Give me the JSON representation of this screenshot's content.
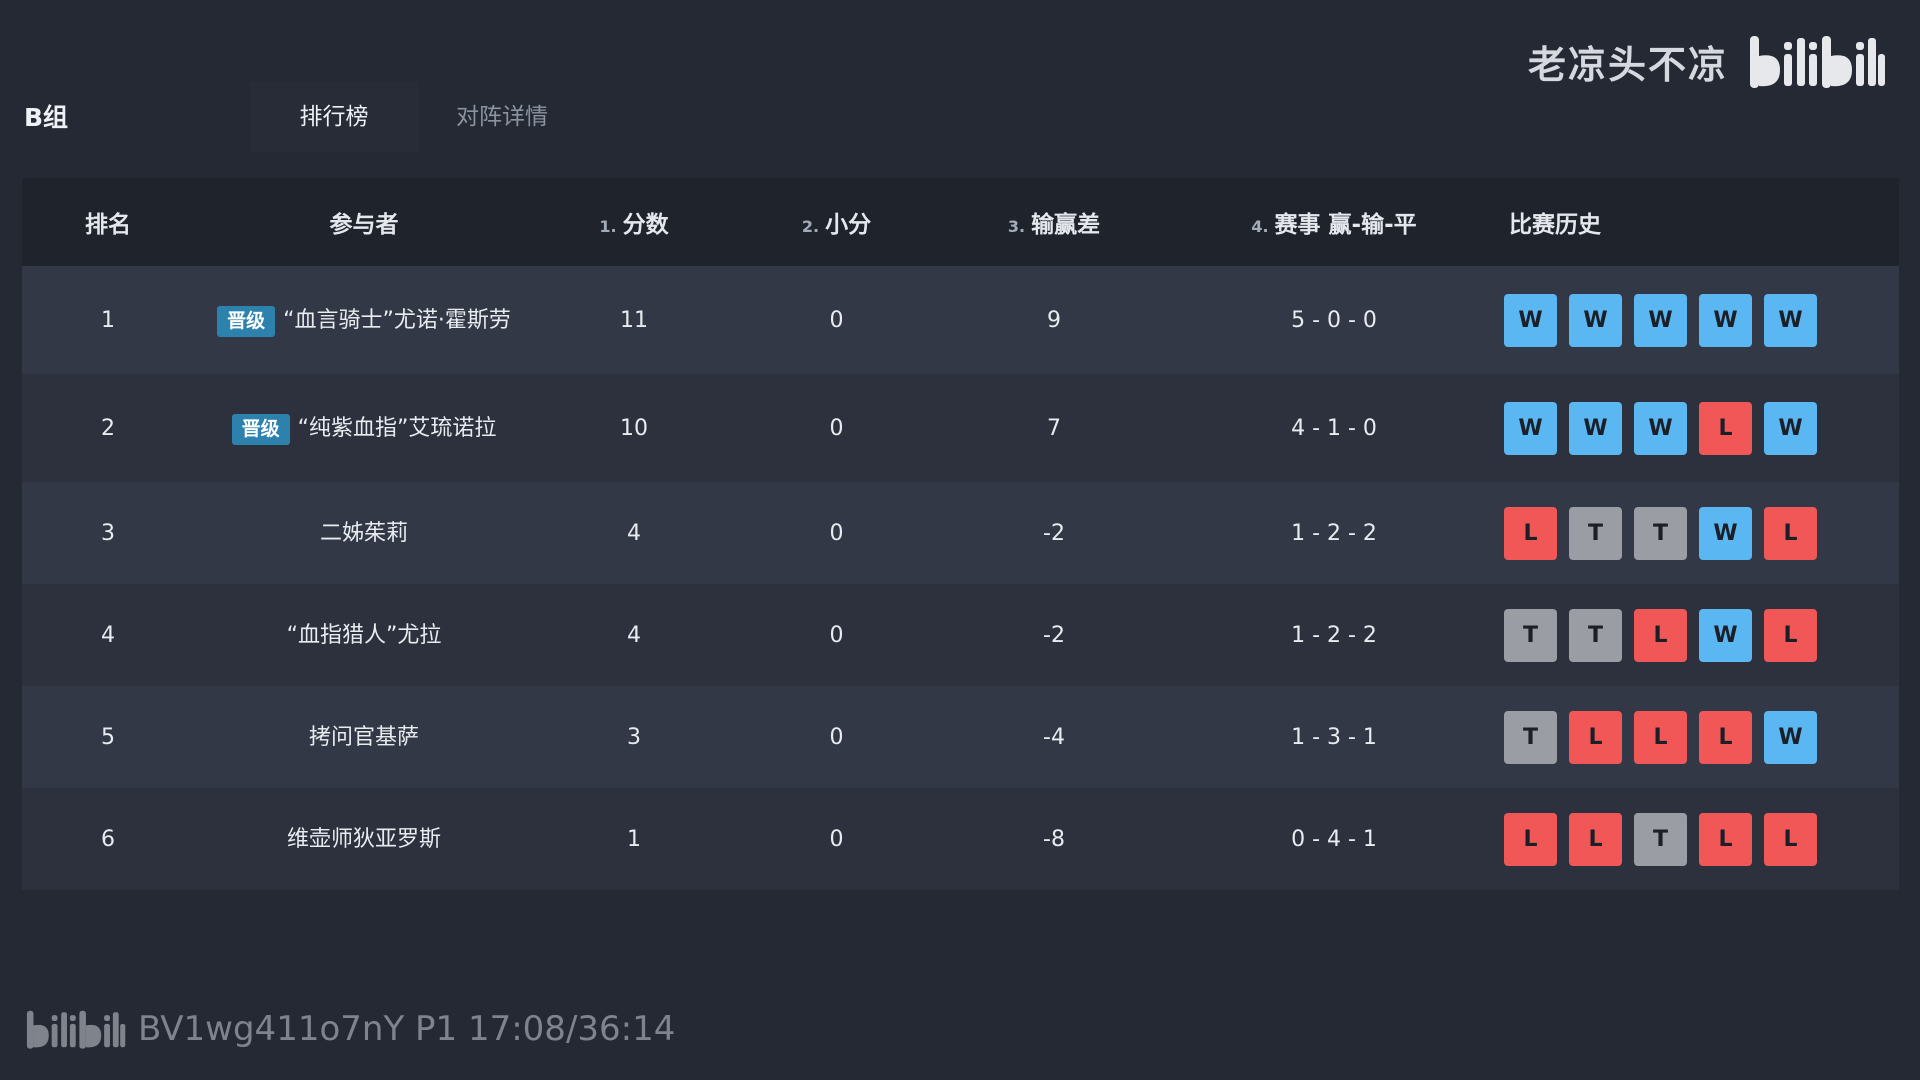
{
  "header": {
    "group_title": "B组",
    "tabs": [
      {
        "label": "排行榜",
        "active": true
      },
      {
        "label": "对阵详情",
        "active": false
      }
    ]
  },
  "watermark": {
    "uploader": "老凉头不凉",
    "logo": "bilibili",
    "video_info": "BV1wg411o7nY P1 17:08/36:14"
  },
  "table": {
    "columns": {
      "rank": "排名",
      "participant": "参与者",
      "score_num": "1.",
      "score": "分数",
      "small_num": "2.",
      "small": "小分",
      "diff_num": "3.",
      "diff": "输赢差",
      "record_num": "4.",
      "record": "赛事 赢-输-平",
      "history": "比赛历史"
    },
    "rows": [
      {
        "rank": "1",
        "badge": "晋级",
        "name": "“血言骑士”尤诺·霍斯劳",
        "score": "11",
        "small": "0",
        "diff": "9",
        "record": "5 - 0 - 0",
        "history": [
          "W",
          "W",
          "W",
          "W",
          "W"
        ]
      },
      {
        "rank": "2",
        "badge": "晋级",
        "name": "“纯紫血指”艾琉诺拉",
        "score": "10",
        "small": "0",
        "diff": "7",
        "record": "4 - 1 - 0",
        "history": [
          "W",
          "W",
          "W",
          "L",
          "W"
        ]
      },
      {
        "rank": "3",
        "badge": "",
        "name": "二姊茱莉",
        "score": "4",
        "small": "0",
        "diff": "-2",
        "record": "1 - 2 - 2",
        "history": [
          "L",
          "T",
          "T",
          "W",
          "L"
        ]
      },
      {
        "rank": "4",
        "badge": "",
        "name": "“血指猎人”尤拉",
        "score": "4",
        "small": "0",
        "diff": "-2",
        "record": "1 - 2 - 2",
        "history": [
          "T",
          "T",
          "L",
          "W",
          "L"
        ]
      },
      {
        "rank": "5",
        "badge": "",
        "name": "拷问官基萨",
        "score": "3",
        "small": "0",
        "diff": "-4",
        "record": "1 - 3 - 1",
        "history": [
          "T",
          "L",
          "L",
          "L",
          "W"
        ]
      },
      {
        "rank": "6",
        "badge": "",
        "name": "维壶师狄亚罗斯",
        "score": "1",
        "small": "0",
        "diff": "-8",
        "record": "0 - 4 - 1",
        "history": [
          "L",
          "L",
          "T",
          "L",
          "L"
        ]
      }
    ]
  },
  "colors": {
    "win": "#5ab7f2",
    "loss": "#f25757",
    "tie": "#9a9da3",
    "badge": "#2d82ad"
  }
}
